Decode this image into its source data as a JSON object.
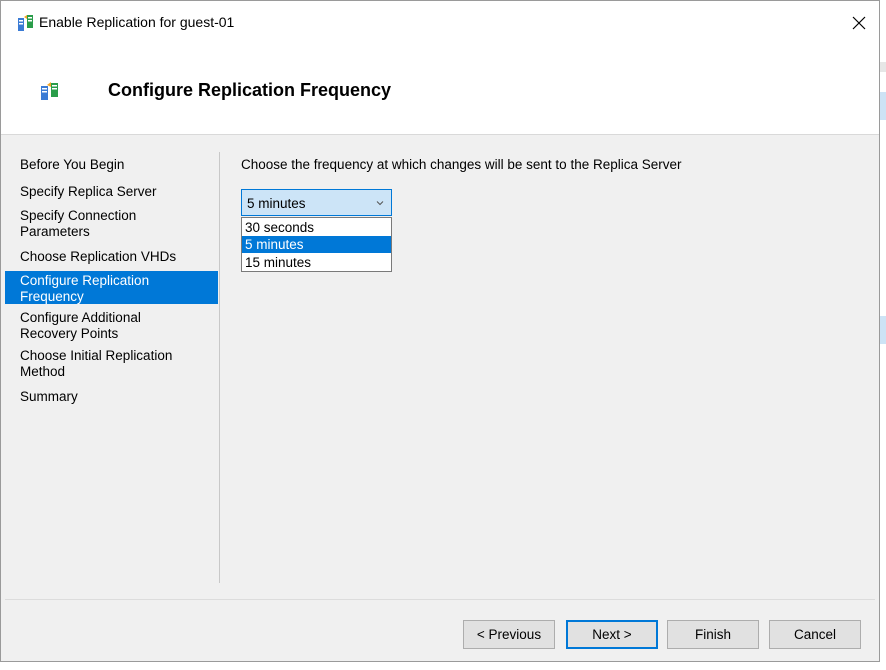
{
  "window": {
    "title": "Enable Replication for guest-01",
    "close_glyph": "✕"
  },
  "header": {
    "title": "Configure Replication Frequency",
    "icon": "replication-icon"
  },
  "nav": {
    "items": [
      {
        "label": "Before You Begin"
      },
      {
        "label": "Specify Replica Server"
      },
      {
        "label": "Specify Connection\nParameters"
      },
      {
        "label": "Choose Replication VHDs"
      },
      {
        "label": "Configure Replication\nFrequency",
        "active": true
      },
      {
        "label": "Configure Additional\nRecovery Points"
      },
      {
        "label": "Choose Initial Replication\nMethod"
      },
      {
        "label": "Summary"
      }
    ]
  },
  "main": {
    "prompt": "Choose the frequency at which changes will be sent to the Replica Server",
    "frequency": {
      "selected": "5 minutes",
      "options": [
        "30 seconds",
        "5 minutes",
        "15 minutes"
      ]
    }
  },
  "buttons": {
    "previous": "< Previous",
    "next": "Next >",
    "finish": "Finish",
    "cancel": "Cancel"
  },
  "colors": {
    "accent": "#0078d7",
    "selection_bg": "#0078d7",
    "combo_bg": "#cce4f7"
  }
}
